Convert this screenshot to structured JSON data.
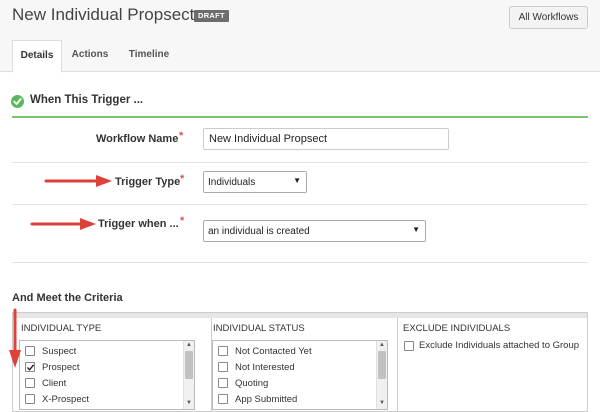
{
  "header": {
    "title": "New Individual Propsect",
    "badge": "DRAFT",
    "all_workflows_button": "All Workflows"
  },
  "tabs": [
    {
      "label": "Details",
      "active": true
    },
    {
      "label": "Actions",
      "active": false
    },
    {
      "label": "Timeline",
      "active": false
    }
  ],
  "trigger_section": {
    "title": "When This Trigger ...",
    "workflow_name_label": "Workflow Name",
    "workflow_name_value": "New Individual Propsect",
    "trigger_type_label": "Trigger Type",
    "trigger_type_value": "Individuals",
    "trigger_when_label": "Trigger when ...",
    "trigger_when_value": "an individual is created",
    "required_marker": "*"
  },
  "criteria": {
    "title": "And Meet the Criteria",
    "individual_type": {
      "header": "INDIVIDUAL TYPE",
      "items": [
        {
          "label": "Suspect",
          "checked": false
        },
        {
          "label": "Prospect",
          "checked": true
        },
        {
          "label": "Client",
          "checked": false
        },
        {
          "label": "X-Prospect",
          "checked": false
        }
      ]
    },
    "individual_status": {
      "header": "INDIVIDUAL STATUS",
      "items": [
        {
          "label": "Not Contacted Yet",
          "checked": false
        },
        {
          "label": "Not Interested",
          "checked": false
        },
        {
          "label": "Quoting",
          "checked": false
        },
        {
          "label": "App Submitted",
          "checked": false
        }
      ]
    },
    "exclude": {
      "header": "EXCLUDE INDIVIDUALS",
      "option_label": "Exclude Individuals attached to Group",
      "checked": false
    }
  },
  "colors": {
    "accent_green": "#5cb85c",
    "annotation_red": "#e0403a",
    "required_red": "#d9534f"
  },
  "icons": {
    "section_status": "check-circle-icon",
    "select_caret": "caret-down-icon",
    "annotation": "red-arrow-icon"
  }
}
